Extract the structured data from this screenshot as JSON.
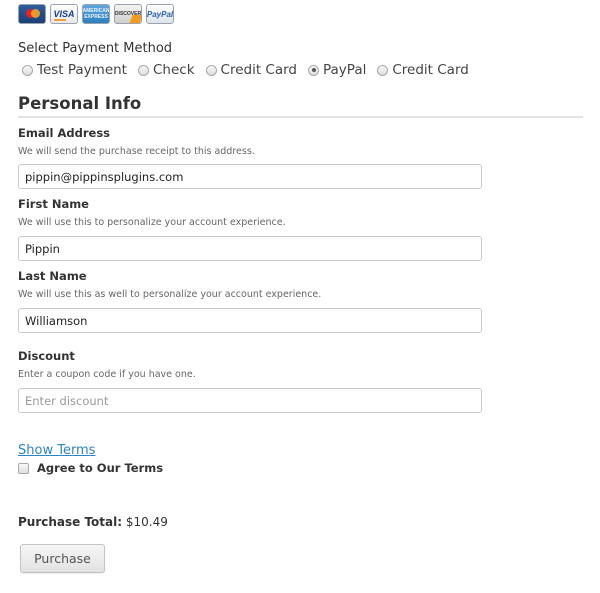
{
  "payment_icons": [
    {
      "name": "mastercard-icon",
      "label": ""
    },
    {
      "name": "visa-icon",
      "label": "VISA"
    },
    {
      "name": "amex-icon",
      "label": "AMERICAN EXPRESS"
    },
    {
      "name": "discover-icon",
      "label": "DISCOVER"
    },
    {
      "name": "paypal-icon",
      "label": "PayPal"
    }
  ],
  "payment_method": {
    "label": "Select Payment Method",
    "options": [
      {
        "label": "Test Payment",
        "checked": false
      },
      {
        "label": "Check",
        "checked": false
      },
      {
        "label": "Credit Card",
        "checked": false
      },
      {
        "label": "PayPal",
        "checked": true
      },
      {
        "label": "Credit Card",
        "checked": false
      }
    ]
  },
  "personal_info": {
    "title": "Personal Info",
    "email": {
      "label": "Email Address",
      "description": "We will send the purchase receipt to this address.",
      "value": "pippin@pippinsplugins.com",
      "placeholder": ""
    },
    "first_name": {
      "label": "First Name",
      "description": "We will use this to personalize your account experience.",
      "value": "Pippin",
      "placeholder": ""
    },
    "last_name": {
      "label": "Last Name",
      "description": "We will use this as well to personalize your account experience.",
      "value": "Williamson",
      "placeholder": ""
    },
    "discount": {
      "label": "Discount",
      "description": "Enter a coupon code if you have one.",
      "value": "",
      "placeholder": "Enter discount"
    }
  },
  "terms": {
    "show_link": "Show Terms",
    "agree_label": "Agree to Our Terms",
    "agreed": false
  },
  "purchase": {
    "total_label": "Purchase Total:",
    "total_value": "$10.49",
    "button_label": "Purchase"
  }
}
